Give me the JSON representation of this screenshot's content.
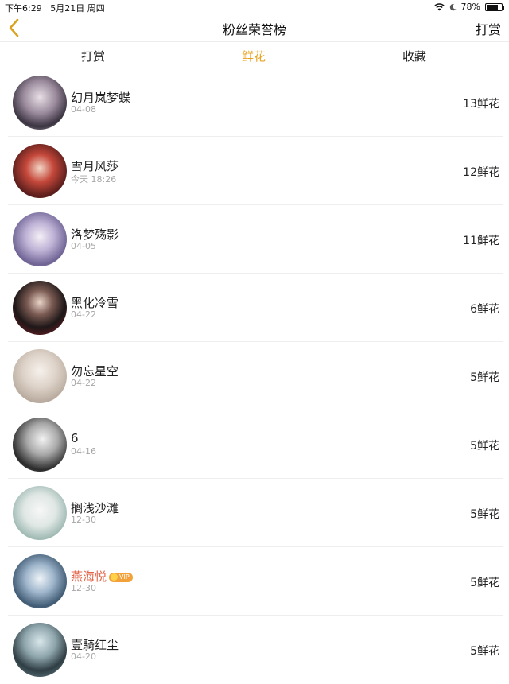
{
  "status": {
    "time": "下午6:29",
    "date": "5月21日 周四",
    "battery": "78%",
    "battery_level": 0.78
  },
  "nav": {
    "title": "粉丝荣誉榜",
    "right": "打赏"
  },
  "tabs": [
    {
      "label": "打赏",
      "active": false
    },
    {
      "label": "鲜花",
      "active": true
    },
    {
      "label": "收藏",
      "active": false
    }
  ],
  "colors": {
    "accent": "#e8a320",
    "vip_name": "#e4664a"
  },
  "fans": [
    {
      "name": "幻月岚梦蝶",
      "date": "04-08",
      "count": "13鲜花",
      "vip": false
    },
    {
      "name": "雪月风莎",
      "date": "今天 18:26",
      "count": "12鲜花",
      "vip": false
    },
    {
      "name": "洛梦殇影",
      "date": "04-05",
      "count": "11鲜花",
      "vip": false
    },
    {
      "name": "黑化冷雪",
      "date": "04-22",
      "count": "6鲜花",
      "vip": false
    },
    {
      "name": "勿忘星空",
      "date": "04-22",
      "count": "5鲜花",
      "vip": false
    },
    {
      "name": "6",
      "date": "04-16",
      "count": "5鲜花",
      "vip": false
    },
    {
      "name": "搁浅沙滩",
      "date": "12-30",
      "count": "5鲜花",
      "vip": false
    },
    {
      "name": "燕海悦",
      "date": "12-30",
      "count": "5鲜花",
      "vip": true,
      "badge": "VIP"
    },
    {
      "name": "壹騎红尘",
      "date": "04-20",
      "count": "5鲜花",
      "vip": false
    }
  ]
}
